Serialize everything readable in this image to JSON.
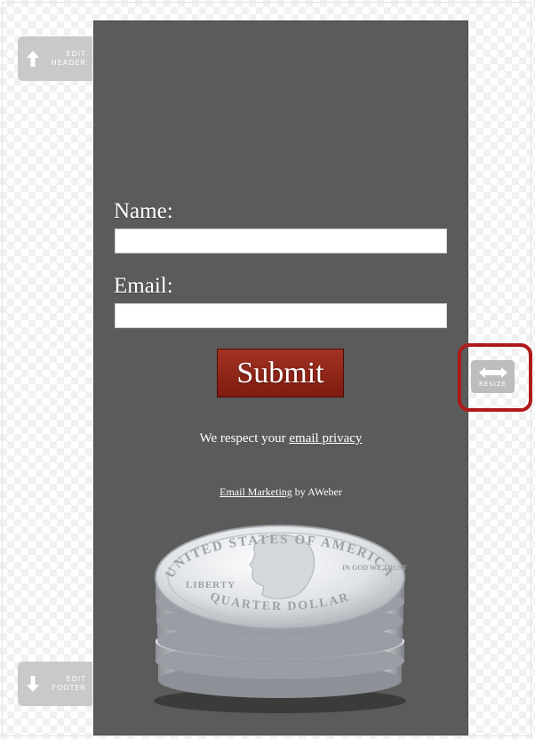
{
  "editor": {
    "edit_header_label": "EDIT HEADER",
    "edit_footer_label": "EDIT FOOTER",
    "resize_label": "RESIZE",
    "highlight_color": "#b01919"
  },
  "form": {
    "name_label": "Name:",
    "name_value": "",
    "email_label": "Email:",
    "email_value": "",
    "submit_label": "Submit",
    "privacy_prefix": "We respect your",
    "privacy_link": "email privacy",
    "marketing_link": "Email Marketing",
    "marketing_suffix": "by AWeber",
    "panel_color": "#5b5b5b",
    "button_color": "#8f2416"
  },
  "coin_image": {
    "top_text": "UNITED STATES OF AMERICA",
    "liberty_text": "LIBERTY",
    "motto_text": "IN GOD WE TRUST",
    "denomination_text": "QUARTER DOLLAR"
  }
}
